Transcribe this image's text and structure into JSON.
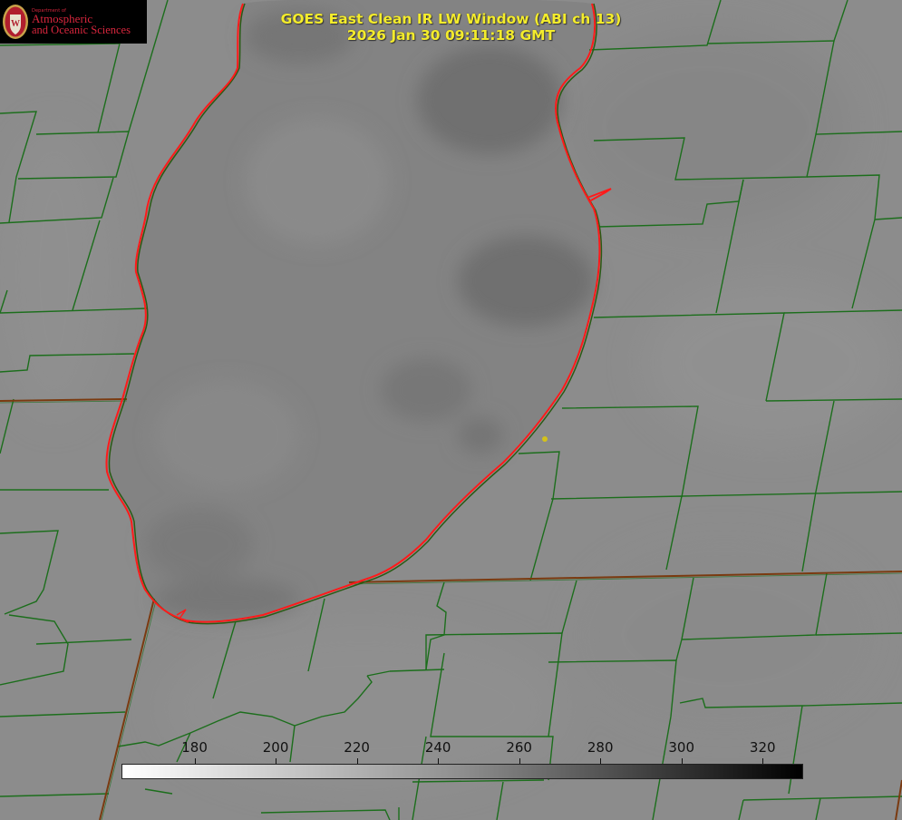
{
  "header": {
    "title_line1": "GOES East Clean IR LW Window (ABI ch 13)",
    "title_line2": "2026 Jan 30 09:11:18 GMT"
  },
  "logo": {
    "dept": "Department of",
    "line1": "Atmospheric",
    "line2": "and Oceanic Sciences",
    "seal_letter": "W"
  },
  "colorbar": {
    "tick_labels": [
      "180",
      "200",
      "220",
      "240",
      "260",
      "280",
      "300",
      "320"
    ],
    "range": [
      162,
      330
    ],
    "colormap": "grayscale, white = cold, black = warm"
  },
  "colors": {
    "county_lines": "#1c6e1c",
    "lake_outline": "#ff1a1a",
    "state_lines": "#7a3a10",
    "title_text": "#f4ec2c",
    "marker": "#d4c21a"
  },
  "map_features": [
    "lake-shoreline",
    "county-boundaries",
    "state-boundaries",
    "location-marker"
  ]
}
